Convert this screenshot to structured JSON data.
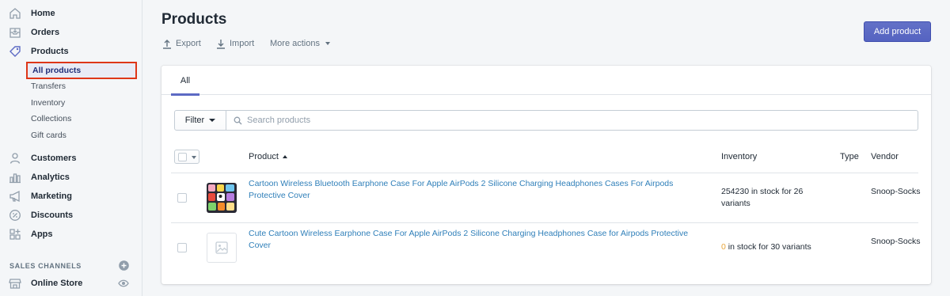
{
  "sidebar": {
    "items": [
      {
        "label": "Home",
        "icon": "home-icon"
      },
      {
        "label": "Orders",
        "icon": "orders-icon"
      },
      {
        "label": "Products",
        "icon": "tag-icon"
      },
      {
        "label": "Customers",
        "icon": "person-icon"
      },
      {
        "label": "Analytics",
        "icon": "bar-chart-icon"
      },
      {
        "label": "Marketing",
        "icon": "megaphone-icon"
      },
      {
        "label": "Discounts",
        "icon": "discount-icon"
      },
      {
        "label": "Apps",
        "icon": "apps-icon"
      }
    ],
    "product_subitems": [
      "All products",
      "Transfers",
      "Inventory",
      "Collections",
      "Gift cards"
    ],
    "active_subitem": "All products",
    "sales_channels_heading": "SALES CHANNELS",
    "online_store_label": "Online Store"
  },
  "page": {
    "title": "Products",
    "actions": {
      "export": "Export",
      "import": "Import",
      "more": "More actions"
    },
    "add_button": "Add product"
  },
  "tabs": [
    {
      "label": "All",
      "selected": true
    }
  ],
  "filter": {
    "label": "Filter",
    "search_placeholder": "Search products"
  },
  "table": {
    "columns": {
      "product": "Product",
      "inventory": "Inventory",
      "type": "Type",
      "vendor": "Vendor"
    },
    "rows": [
      {
        "title": "Cartoon Wireless Bluetooth Earphone Case For Apple AirPods 2 Silicone Charging Headphones Cases For Airpods Protective Cover",
        "inventory_count": "254230",
        "inventory_text": " in stock for 26 variants",
        "type": "",
        "vendor": "Snoop-Socks",
        "has_image": true
      },
      {
        "title": "Cute Cartoon Wireless Earphone Case For Apple AirPods 2 Silicone Charging Headphones Case for Airpods Protective Cover",
        "inventory_count": "0",
        "inventory_text": " in stock for 30 variants",
        "type": "",
        "vendor": "Snoop-Socks",
        "has_image": false
      }
    ]
  },
  "colors": {
    "accent": "#5c6ac4",
    "link": "#2f7fb9",
    "warning": "#e8a53a",
    "highlight_border": "#de3618"
  }
}
